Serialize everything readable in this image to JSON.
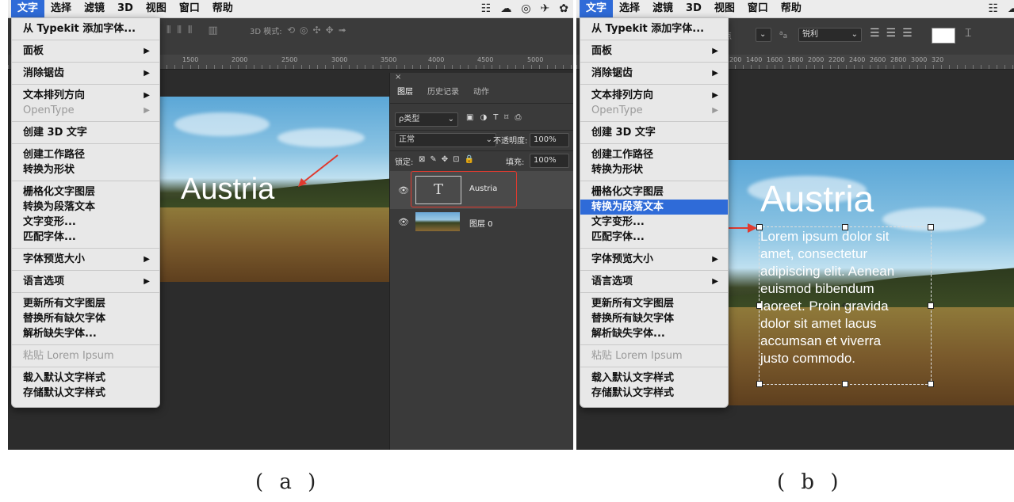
{
  "menubar": {
    "items": [
      "文字",
      "选择",
      "滤镜",
      "3D",
      "视图",
      "窗口",
      "帮助"
    ]
  },
  "toolbar": {
    "mode_3d_label": "3D 模式:",
    "size_unit": "点",
    "aa_prefix": "a",
    "aa_label": "a",
    "antialias": "锐利"
  },
  "ruler_a": [
    "1500",
    "2000",
    "2500",
    "3000",
    "3500",
    "4000",
    "4500",
    "5000"
  ],
  "ruler_b": [
    "1200",
    "1400",
    "1600",
    "1800",
    "2000",
    "2200",
    "2400",
    "2600",
    "2800",
    "3000",
    "320"
  ],
  "menu": {
    "groups": [
      [
        {
          "label": "从 Typekit 添加字体...",
          "arrow": false
        }
      ],
      [
        {
          "label": "面板",
          "arrow": true
        }
      ],
      [
        {
          "label": "消除锯齿",
          "arrow": true
        }
      ],
      [
        {
          "label": "文本排列方向",
          "arrow": true
        },
        {
          "label": "OpenType",
          "arrow": true,
          "disabled": true
        }
      ],
      [
        {
          "label": "创建 3D 文字",
          "arrow": false
        }
      ],
      [
        {
          "label": "创建工作路径",
          "arrow": false
        },
        {
          "label": "转换为形状",
          "arrow": false
        }
      ],
      [
        {
          "label": "栅格化文字图层",
          "arrow": false
        },
        {
          "label": "转换为段落文本",
          "arrow": false,
          "highlight_b": true
        },
        {
          "label": "文字变形...",
          "arrow": false
        },
        {
          "label": "匹配字体...",
          "arrow": false
        }
      ],
      [
        {
          "label": "字体预览大小",
          "arrow": true
        }
      ],
      [
        {
          "label": "语言选项",
          "arrow": true
        }
      ],
      [
        {
          "label": "更新所有文字图层",
          "arrow": false
        },
        {
          "label": "替换所有缺欠字体",
          "arrow": false
        },
        {
          "label": "解析缺失字体...",
          "arrow": false
        }
      ],
      [
        {
          "label": "粘贴 Lorem Ipsum",
          "arrow": false,
          "disabled": true
        }
      ],
      [
        {
          "label": "载入默认文字样式",
          "arrow": false
        },
        {
          "label": "存储默认文字样式",
          "arrow": false
        }
      ]
    ]
  },
  "layers_panel": {
    "close": "×",
    "tabs": [
      "图层",
      "历史记录",
      "动作"
    ],
    "filter_label": "ρ类型",
    "filter_icons": [
      "▣",
      "◑",
      "T",
      "⌑",
      "⎙"
    ],
    "blend_mode": "正常",
    "opacity_label": "不透明度:",
    "opacity_value": "100%",
    "lock_label": "锁定:",
    "lock_icons": [
      "⊠",
      "✎",
      "✥",
      "⊡",
      "🔒"
    ],
    "fill_label": "填充:",
    "fill_value": "100%",
    "layers": [
      {
        "name": "Austria",
        "type": "text",
        "thumb_glyph": "T"
      },
      {
        "name": "图层 0",
        "type": "image"
      }
    ]
  },
  "canvas_a": {
    "headline": "Austria"
  },
  "canvas_b": {
    "headline": "Austria",
    "paragraph_lines": [
      "Lorem ipsum dolor sit",
      "amet, consectetur",
      "adipiscing elit. Aenean",
      "euismod bibendum",
      "laoreet. Proin gravida",
      "dolor sit amet lacus",
      "accumsan et viverra",
      "justo commodo."
    ]
  },
  "captions": [
    "( a )",
    "( b )"
  ],
  "colors": {
    "accent": "#2f6bd8",
    "annotation": "#e03a2f"
  }
}
